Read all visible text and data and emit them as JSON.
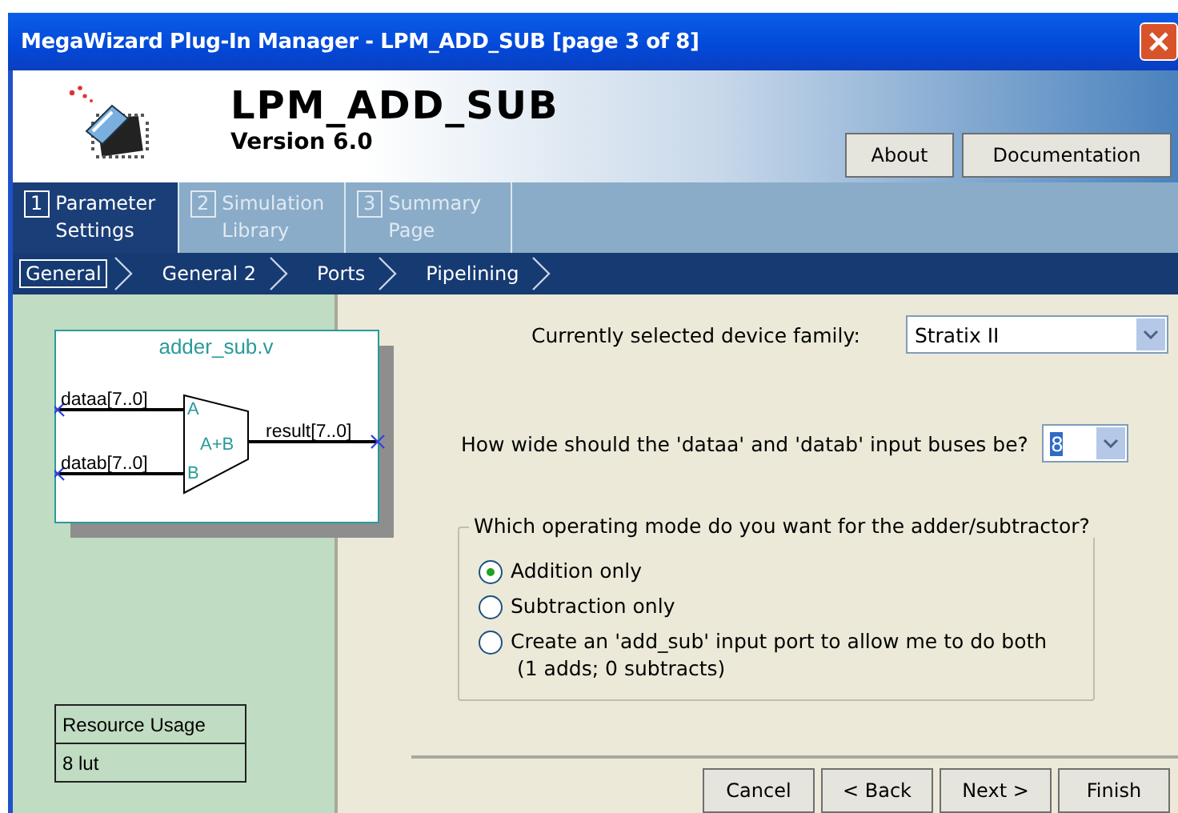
{
  "window": {
    "title": "MegaWizard Plug-In Manager - LPM_ADD_SUB [page 3 of 8]"
  },
  "header": {
    "title": "LPM_ADD_SUB",
    "version": "Version 6.0",
    "buttons": [
      "About",
      "Documentation"
    ]
  },
  "steps": [
    {
      "number": "1",
      "label": "Parameter Settings",
      "selected": true
    },
    {
      "number": "2",
      "label": "Simulation Library",
      "selected": false
    },
    {
      "number": "3",
      "label": "Summary Page",
      "selected": false
    }
  ],
  "subpages": [
    {
      "label": "General",
      "selected": true
    },
    {
      "label": "General 2",
      "selected": false
    },
    {
      "label": "Ports",
      "selected": false
    },
    {
      "label": "Pipelining",
      "selected": false
    }
  ],
  "diagram": {
    "title": "adder_sub.v",
    "inputs": [
      "dataa[7..0]",
      "datab[7..0]"
    ],
    "ports": [
      "A",
      "B"
    ],
    "operation": "A+B",
    "output": "result[7..0]"
  },
  "resource_usage": {
    "title": "Resource Usage",
    "value": "8 lut"
  },
  "device_family": {
    "label": "Currently selected device family:",
    "value": "Stratix II"
  },
  "bus_width": {
    "label": "How wide should the 'dataa' and 'datab' input buses be?",
    "value": "8",
    "highlighted": true
  },
  "mode": {
    "legend": "Which operating mode do you want for the adder/subtractor?",
    "options": [
      {
        "label": "Addition only",
        "selected": true
      },
      {
        "label": "Subtraction only",
        "selected": false
      },
      {
        "label": "Create an 'add_sub' input port to allow me to do both",
        "note": "(1 adds; 0 subtracts)",
        "selected": false
      }
    ]
  },
  "buttons": [
    "Cancel",
    "< Back",
    "Next >",
    "Finish"
  ]
}
